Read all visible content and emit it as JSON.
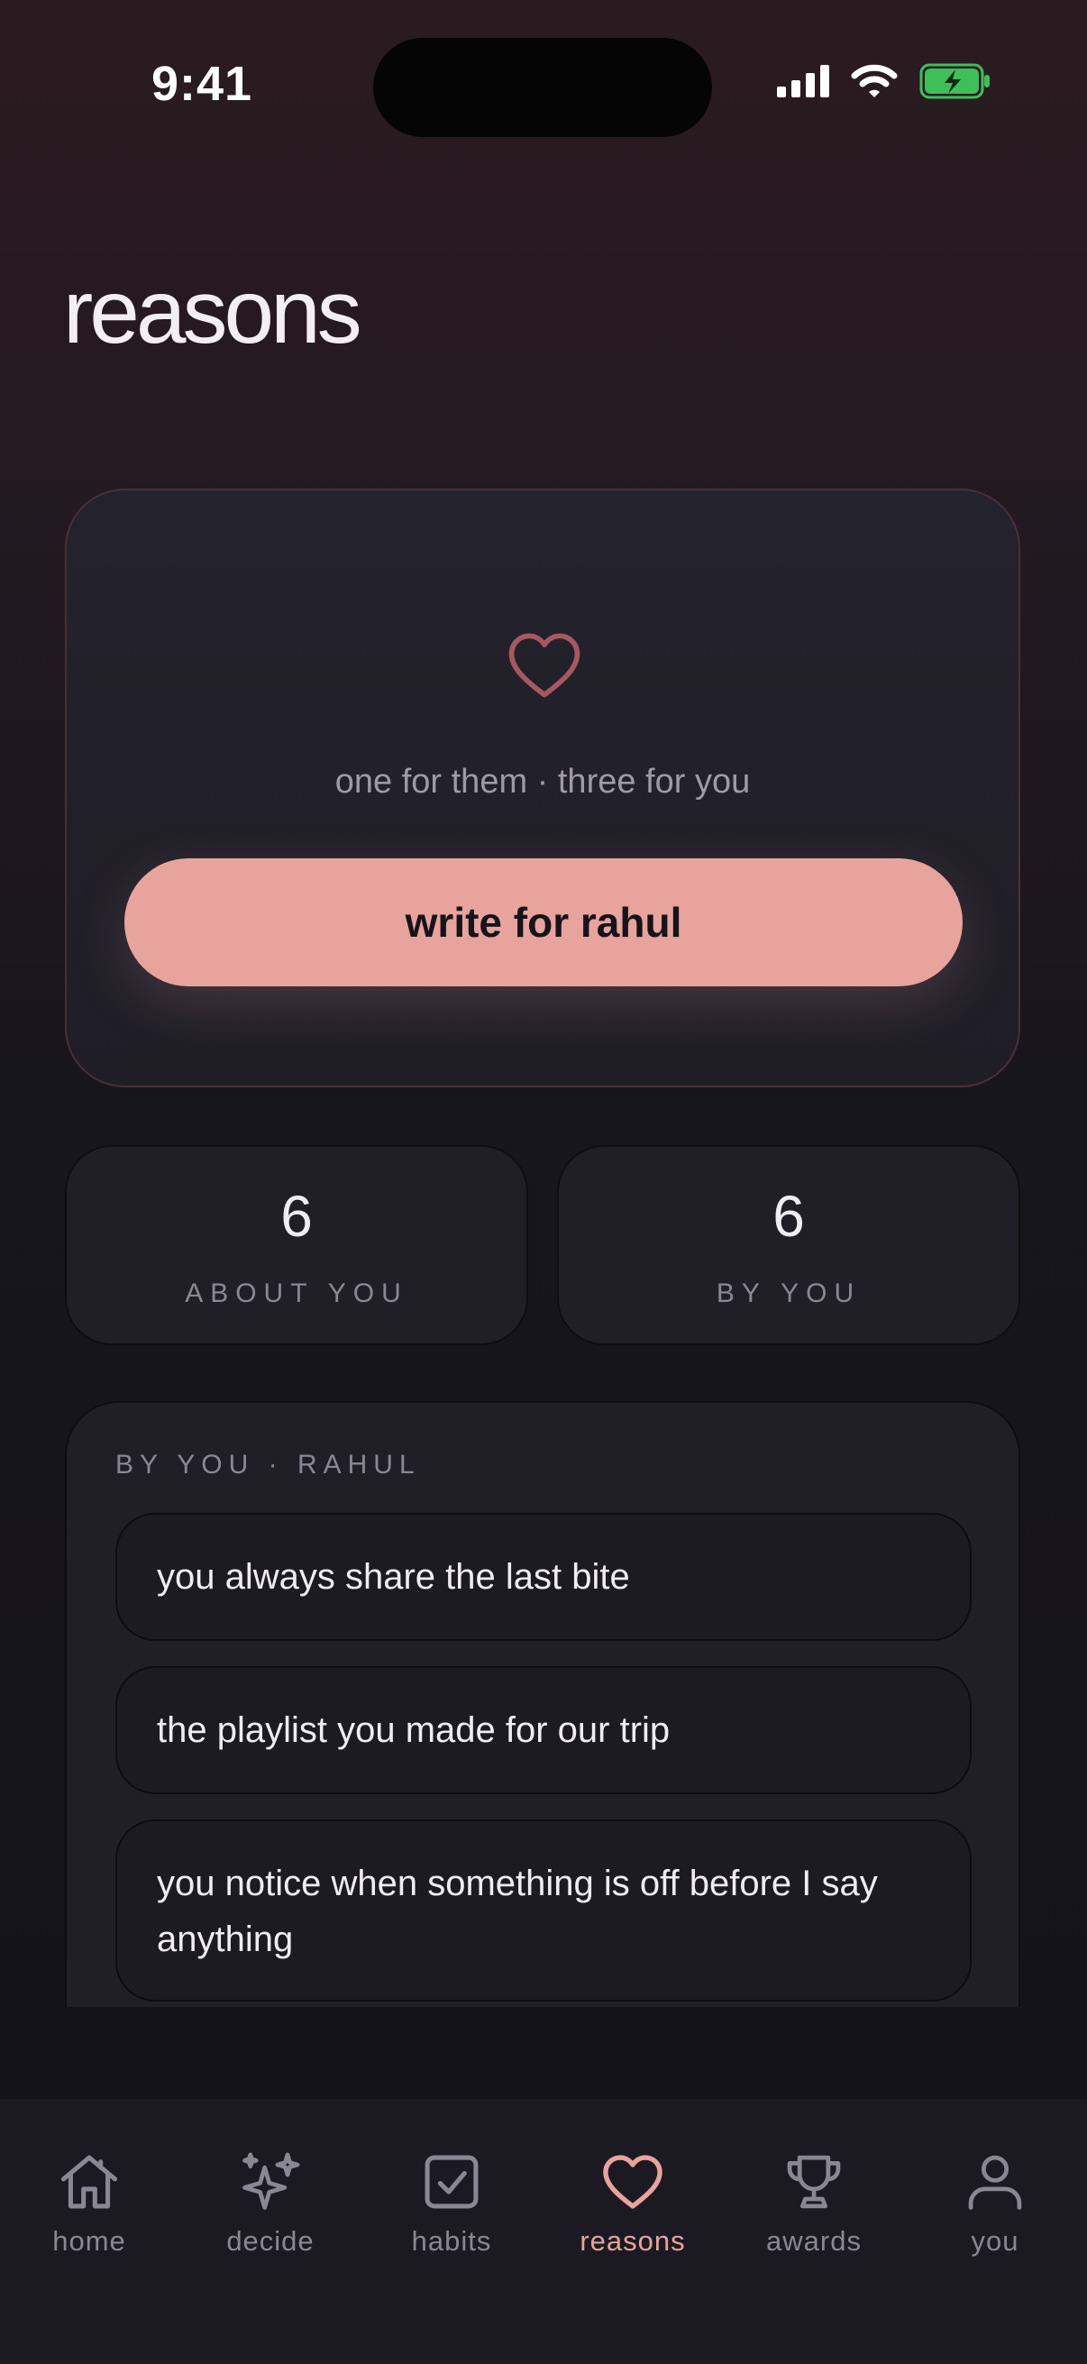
{
  "status_bar": {
    "time": "9:41"
  },
  "page": {
    "title": "reasons"
  },
  "hero": {
    "subtitle": "one for them · three for you",
    "cta_label": "write for rahul"
  },
  "stats": [
    {
      "value": "6",
      "label": "ABOUT YOU"
    },
    {
      "value": "6",
      "label": "BY YOU"
    }
  ],
  "reasons_list": {
    "heading": "BY YOU · RAHUL",
    "items": [
      "you always share the last bite",
      "the playlist you made for our trip",
      "you notice when something is off before I say anything"
    ]
  },
  "tabbar": {
    "items": [
      {
        "label": "home",
        "icon": "home-icon"
      },
      {
        "label": "decide",
        "icon": "sparkles-icon"
      },
      {
        "label": "habits",
        "icon": "checkbox-icon"
      },
      {
        "label": "reasons",
        "icon": "heart-icon",
        "active": true
      },
      {
        "label": "awards",
        "icon": "trophy-icon"
      },
      {
        "label": "you",
        "icon": "person-icon"
      }
    ]
  },
  "colors": {
    "accent": "#e8a39d",
    "card": "#201f28",
    "muted_text": "#8b8795"
  }
}
